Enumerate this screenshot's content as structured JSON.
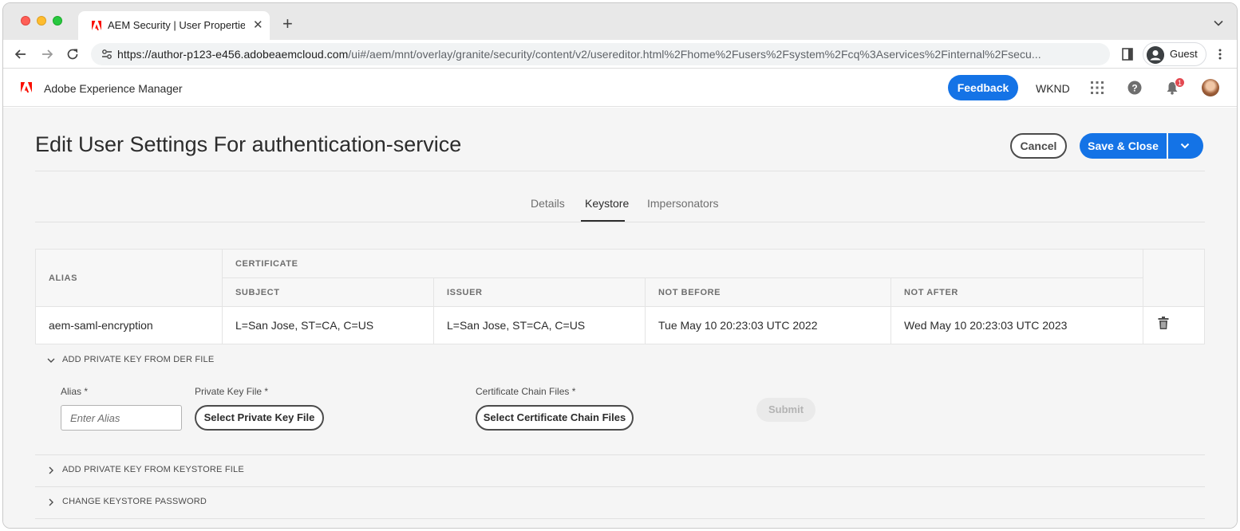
{
  "browser": {
    "tab_title": "AEM Security | User Properties",
    "url_host": "https://author-p123-e456.adobeaemcloud.com",
    "url_path": "/ui#/aem/mnt/overlay/granite/security/content/v2/usereditor.html%2Fhome%2Fusers%2Fsystem%2Fcq%3Aservices%2Finternal%2Fsecu...",
    "profile_label": "Guest"
  },
  "shell": {
    "product_name": "Adobe Experience Manager",
    "feedback_label": "Feedback",
    "org_name": "WKND",
    "notification_count": "1"
  },
  "page": {
    "title": "Edit User Settings For authentication-service",
    "cancel_label": "Cancel",
    "save_label": "Save & Close",
    "tabs": [
      {
        "label": "Details",
        "active": false
      },
      {
        "label": "Keystore",
        "active": true
      },
      {
        "label": "Impersonators",
        "active": false
      }
    ]
  },
  "keystore": {
    "headers": {
      "alias": "ALIAS",
      "certificate": "CERTIFICATE",
      "subject": "SUBJECT",
      "issuer": "ISSUER",
      "not_before": "NOT BEFORE",
      "not_after": "NOT AFTER"
    },
    "rows": [
      {
        "alias": "aem-saml-encryption",
        "subject": "L=San Jose, ST=CA, C=US",
        "issuer": "L=San Jose, ST=CA, C=US",
        "not_before": "Tue May 10 20:23:03 UTC 2022",
        "not_after": "Wed May 10 20:23:03 UTC 2023"
      }
    ]
  },
  "der_section": {
    "label": "ADD PRIVATE KEY FROM DER FILE",
    "expanded": true,
    "alias_label": "Alias *",
    "alias_placeholder": "Enter Alias",
    "alias_value": "",
    "private_key_label": "Private Key File *",
    "private_key_button": "Select Private Key File",
    "cert_chain_label": "Certificate Chain Files *",
    "cert_chain_button": "Select Certificate Chain Files",
    "submit_label": "Submit"
  },
  "keystore_file_section": {
    "label": "ADD PRIVATE KEY FROM KEYSTORE FILE",
    "expanded": false
  },
  "password_section": {
    "label": "CHANGE KEYSTORE PASSWORD",
    "expanded": false
  },
  "colors": {
    "accent": "#1473e6",
    "badge": "#e34850"
  }
}
